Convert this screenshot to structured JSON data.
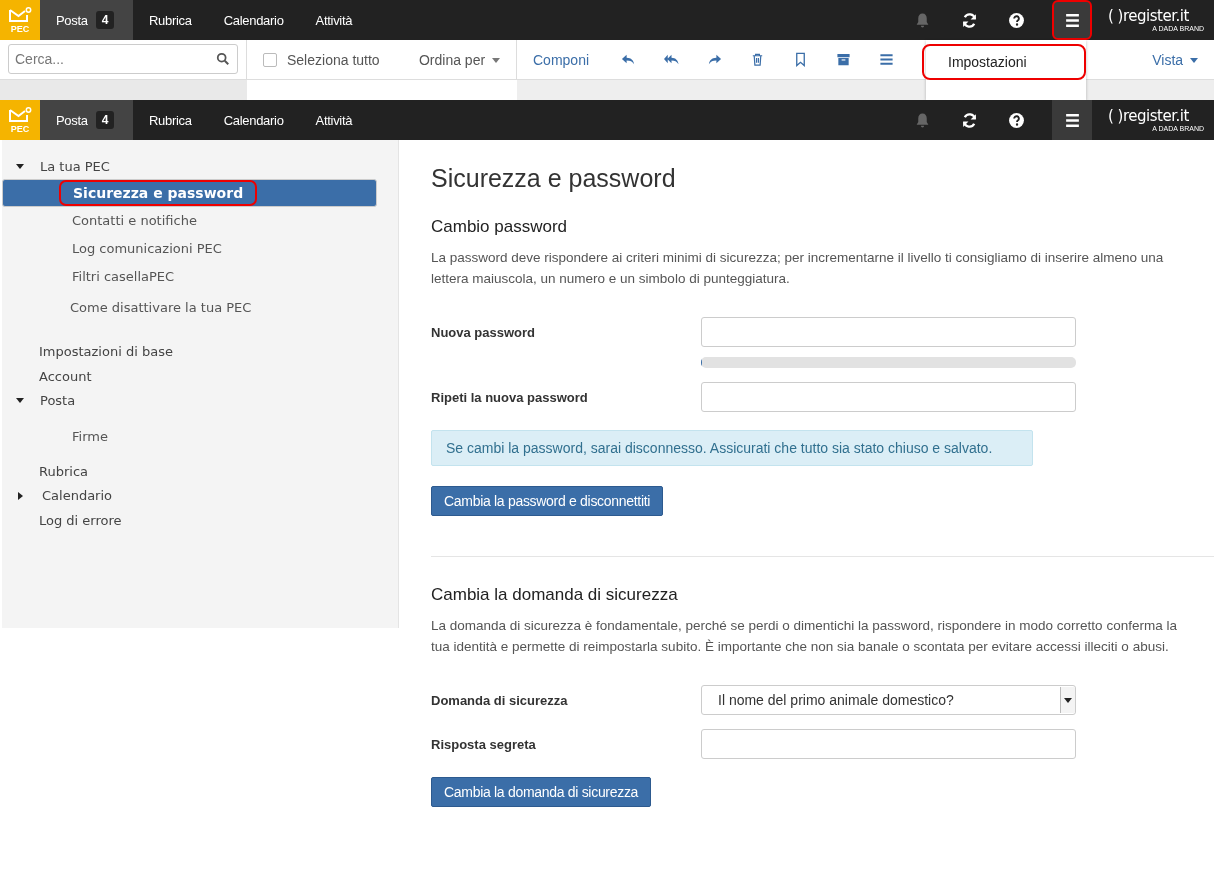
{
  "background_screen": {
    "header": {
      "logo": "PEC",
      "tabs": [
        {
          "label": "Posta",
          "badge": "4",
          "selected": true
        },
        {
          "label": "Rubrica",
          "selected": false
        },
        {
          "label": "Calendario",
          "selected": false
        },
        {
          "label": "Attività",
          "selected": false
        }
      ],
      "menu_highlighted": true,
      "brand": "( )register.it",
      "brand_sub": "A DADA BRAND"
    },
    "search": {
      "placeholder": "Cerca..."
    },
    "select_all": {
      "label": "Seleziona tutto",
      "checked": false
    },
    "sort": "Ordina per",
    "compose": "Componi",
    "view": "Vista",
    "menu": [
      {
        "label": "Impostazioni",
        "highlighted": true
      }
    ]
  },
  "screen": {
    "header": {
      "logo": "PEC",
      "tabs": [
        {
          "label": "Posta",
          "badge": "4",
          "selected": true
        },
        {
          "label": "Rubrica",
          "selected": false
        },
        {
          "label": "Calendario",
          "selected": false
        },
        {
          "label": "Attività",
          "selected": false
        }
      ],
      "menu_highlighted": false,
      "brand": "( )register.it",
      "brand_sub": "A DADA BRAND"
    },
    "sidebar": [
      {
        "label": "La tua PEC",
        "expanded": true,
        "selected": false,
        "children": [
          {
            "label": "Sicurezza e password",
            "selected": true,
            "highlighted": true
          },
          {
            "label": "Contatti e notifiche",
            "selected": false,
            "highlighted": false
          },
          {
            "label": "Log comunicazioni PEC",
            "selected": false,
            "highlighted": false
          },
          {
            "label": "Filtri  casellaPEC",
            "selected": false,
            "highlighted": false
          },
          {
            "label": "Come disattivare la tua PEC",
            "selected": false,
            "highlighted": false
          }
        ]
      },
      {
        "label": "Impostazioni di base",
        "selected": false
      },
      {
        "label": "Account",
        "selected": false
      },
      {
        "label": "Posta",
        "expanded": true,
        "selected": false,
        "children": [
          {
            "label": "Firme",
            "selected": false,
            "highlighted": false
          }
        ]
      },
      {
        "label": "Rubrica",
        "selected": false
      },
      {
        "label": "Calendario",
        "expanded": false,
        "selected": false
      },
      {
        "label": "Log di errore",
        "selected": false
      }
    ],
    "title": "Sicurezza e password",
    "sections": [
      {
        "heading": "Cambio password",
        "description": "La password deve rispondere ai criteri minimi di sicurezza; per incrementarne il livello ti consigliamo di inserire almeno una lettera maiuscola, un numero e un simbolo di punteggiatura.",
        "fields": [
          {
            "label": "Nuova password",
            "kind": "password",
            "strength": {
              "level": 0
            }
          },
          {
            "label": "Ripeti la nuova password",
            "kind": "password"
          }
        ],
        "alert": "Se cambi la password, sarai disconnesso. Assicurati che tutto sia stato chiuso e salvato.",
        "button": "Cambia la password e disconnettiti"
      },
      {
        "heading": "Cambia la domanda di sicurezza",
        "description": "La domanda di sicurezza è fondamentale, perché se perdi o dimentichi la password, rispondere in modo corretto conferma la tua identità e permette di reimpostarla subito. È importante che non sia banale o scontata per evitare accessi illeciti o abusi.",
        "fields": [
          {
            "label": "Domanda di sicurezza",
            "kind": "select",
            "value": "Il nome del primo animale domestico?"
          },
          {
            "label": "Risposta segreta",
            "kind": "text"
          }
        ],
        "button": "Cambia la domanda di sicurezza"
      }
    ]
  }
}
